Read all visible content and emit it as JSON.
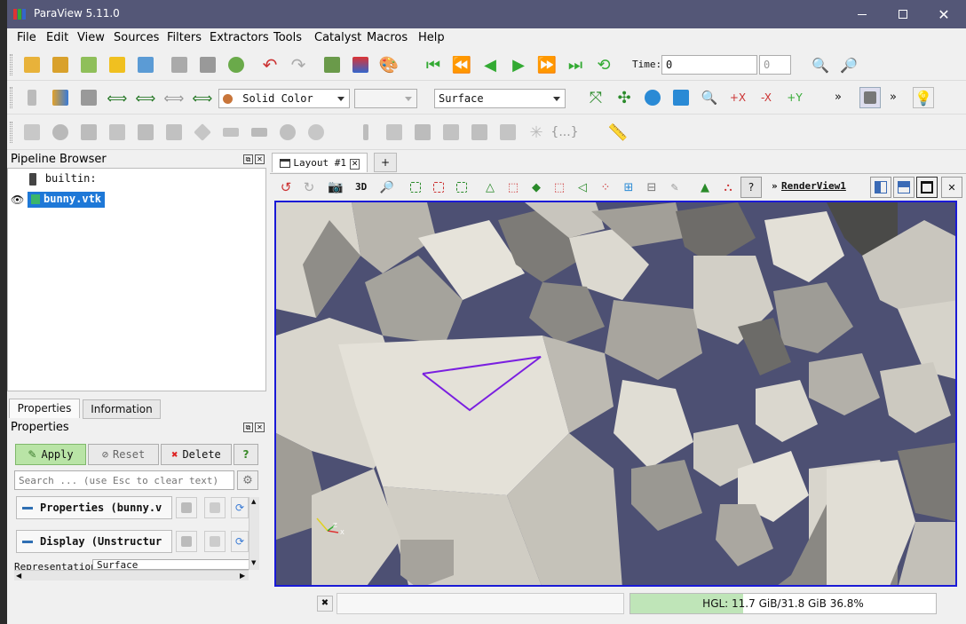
{
  "window": {
    "title": "ParaView 5.11.0"
  },
  "menubar": [
    "File",
    "Edit",
    "View",
    "Sources",
    "Filters",
    "Extractors",
    "Tools",
    "Catalyst",
    "Macros",
    "Help"
  ],
  "time": {
    "label": "Time:",
    "value": "0",
    "step": "0"
  },
  "toolbar2": {
    "color_by": "Solid Color",
    "component": "",
    "representation": "Surface"
  },
  "pipeline": {
    "title": "Pipeline Browser",
    "root": "builtin:",
    "source": "bunny.vtk"
  },
  "layout_tab": {
    "label": "Layout #1",
    "add": "+"
  },
  "view": {
    "mode_3d": "3D",
    "name": "RenderView1",
    "prefix": "»"
  },
  "props_tabs": [
    "Properties",
    "Information"
  ],
  "properties": {
    "title": "Properties",
    "apply": "Apply",
    "reset": "Reset",
    "delete": "Delete",
    "help": "?",
    "search_placeholder": "Search ... (use Esc to clear text)",
    "section_properties": "Properties (bunny.v",
    "section_display": "Display (Unstructur",
    "representation_label": "Representation",
    "representation_value": "Surface"
  },
  "status": {
    "memory": "HGL: 11.7 GiB/31.8 GiB 36.8%",
    "memory_fraction": 0.368
  },
  "colors": {
    "titlebar": "#545777",
    "viewport_bg": "#4d5073",
    "selection": "#7a1fe0",
    "active_border": "#1a1ad6"
  }
}
